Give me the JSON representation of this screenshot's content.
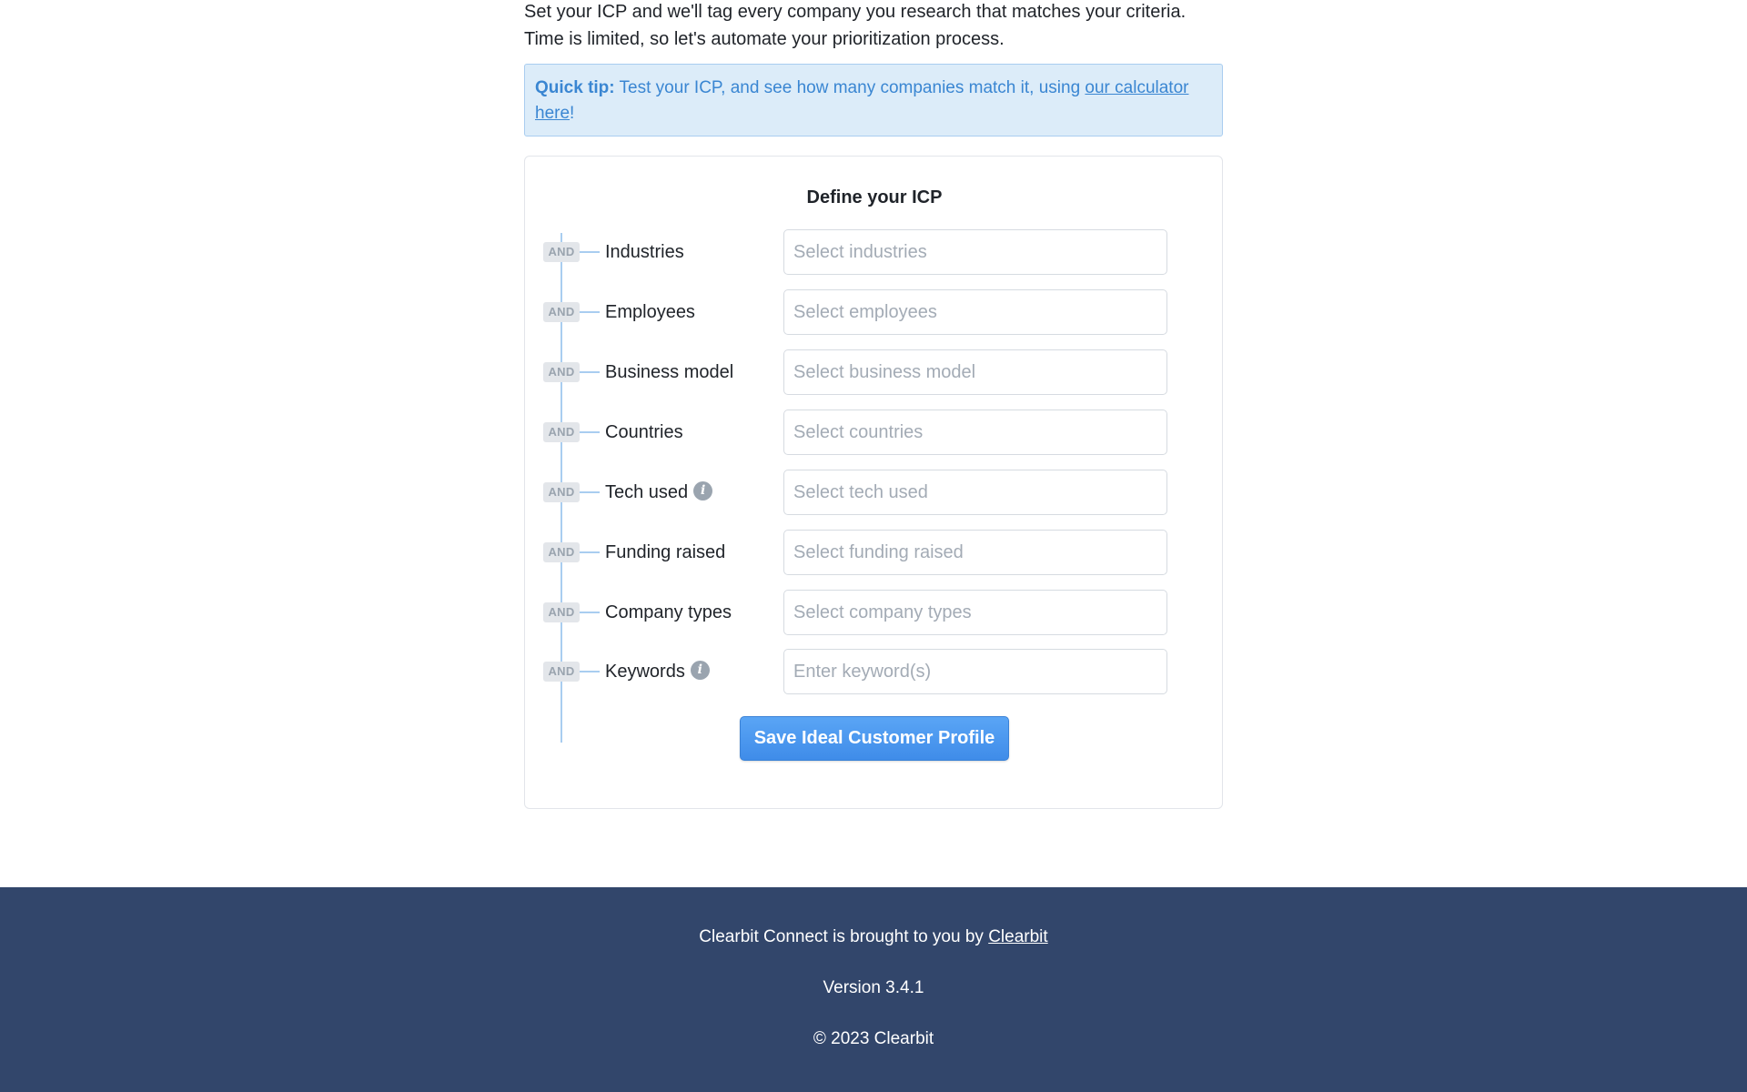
{
  "intro": {
    "line1": "Set your ICP and we'll tag every company you research that matches your criteria.",
    "line2": "Time is limited, so let's automate your prioritization process."
  },
  "tip": {
    "label": "Quick tip:",
    "text": " Test your ICP, and see how many companies match it, using ",
    "link_text": "our calculator here",
    "suffix": "!"
  },
  "card": {
    "title": "Define your ICP",
    "connector": "AND",
    "rows": [
      {
        "label": "Industries",
        "placeholder": "Select industries",
        "info_icon": false
      },
      {
        "label": "Employees",
        "placeholder": "Select employees",
        "info_icon": false
      },
      {
        "label": "Business model",
        "placeholder": "Select business model",
        "info_icon": false
      },
      {
        "label": "Countries",
        "placeholder": "Select countries",
        "info_icon": false
      },
      {
        "label": "Tech used",
        "placeholder": "Select tech used",
        "info_icon": true
      },
      {
        "label": "Funding raised",
        "placeholder": "Select funding raised",
        "info_icon": false
      },
      {
        "label": "Company types",
        "placeholder": "Select company types",
        "info_icon": false
      },
      {
        "label": "Keywords",
        "placeholder": "Enter keyword(s)",
        "info_icon": true
      }
    ],
    "save_label": "Save Ideal Customer Profile"
  },
  "footer": {
    "brought_by_text": "Clearbit Connect is brought to you by ",
    "brought_by_link": "Clearbit",
    "version": "Version 3.4.1",
    "copyright": "© 2023 Clearbit"
  },
  "colors": {
    "accent": "#3f8ce9",
    "tip_background": "#dcecf9",
    "footer_background": "#32466b"
  }
}
